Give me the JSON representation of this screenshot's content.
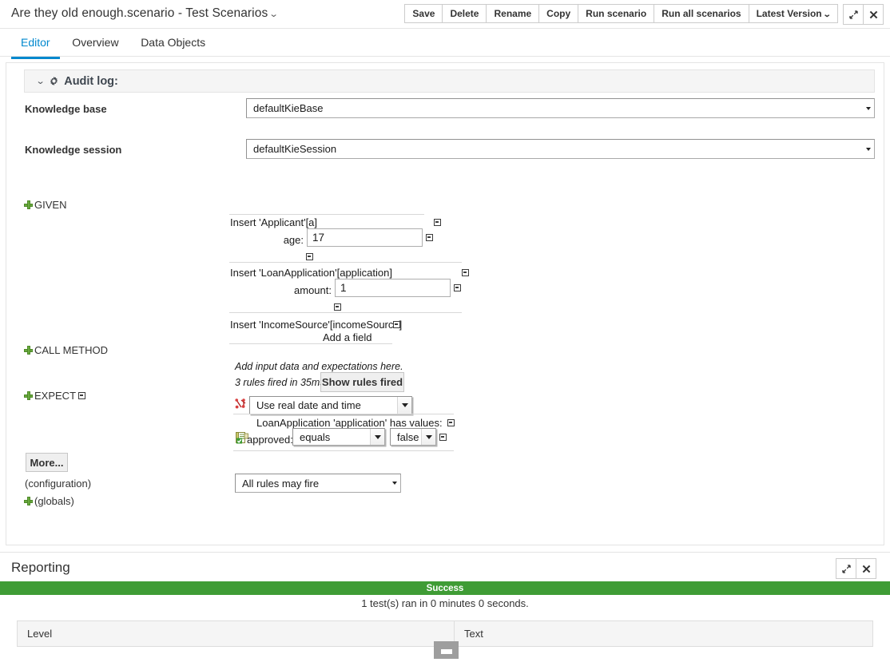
{
  "header": {
    "doc_title": "Are they old enough.scenario - Test Scenarios",
    "title_caret": "⌄",
    "toolbar": {
      "save": "Save",
      "delete": "Delete",
      "rename": "Rename",
      "copy": "Copy",
      "run_scenario": "Run scenario",
      "run_all_scenarios": "Run all scenarios",
      "version": "Latest Version",
      "version_caret": "⌄",
      "maximize_icon": "expand-icon",
      "close_icon": "close-icon"
    }
  },
  "tabs": [
    {
      "label": "Editor",
      "active": true
    },
    {
      "label": "Overview",
      "active": false
    },
    {
      "label": "Data Objects",
      "active": false
    }
  ],
  "editor": {
    "audit_log": {
      "chevron": "⌄",
      "gear_icon": "gear-icon",
      "label": "Audit log:"
    },
    "knowledge_base": {
      "label": "Knowledge base",
      "value": "defaultKieBase"
    },
    "knowledge_session": {
      "label": "Knowledge session",
      "value": "defaultKieSession"
    },
    "sections": {
      "given": "GIVEN",
      "call_method": "CALL METHOD",
      "expect": "EXPECT",
      "configuration": "(configuration)",
      "globals": "(globals)"
    },
    "facts": [
      {
        "title": "Insert 'Applicant'[a]",
        "field_label": "age:",
        "field_value": "17"
      },
      {
        "title": "Insert 'LoanApplication'[application]",
        "field_label": "amount:",
        "field_value": "1"
      },
      {
        "title": "Insert 'IncomeSource'[incomeSource]",
        "add_field": "Add a field"
      }
    ],
    "hints": {
      "add_input": "Add input data and expectations here.",
      "rules_fired": "3 rules fired in 35ms.",
      "show_rules_fired": "Show rules fired"
    },
    "date_select": {
      "icon": "real-date-icon",
      "value": "Use real date and time"
    },
    "expectation": {
      "title": "LoanApplication 'application' has values:",
      "icon": "verify-fact-icon",
      "field_label": "approved:",
      "operator": "equals",
      "value": "false"
    },
    "more_button": "More...",
    "rules_config": "All rules may fire"
  },
  "reporting": {
    "title": "Reporting",
    "maximize_icon": "expand-icon",
    "close_icon": "close-icon",
    "status": "Success",
    "status_color": "#3f9c35",
    "summary": "1 test(s) ran in 0 minutes 0 seconds.",
    "columns": [
      "Level",
      "Text"
    ],
    "rows": []
  }
}
